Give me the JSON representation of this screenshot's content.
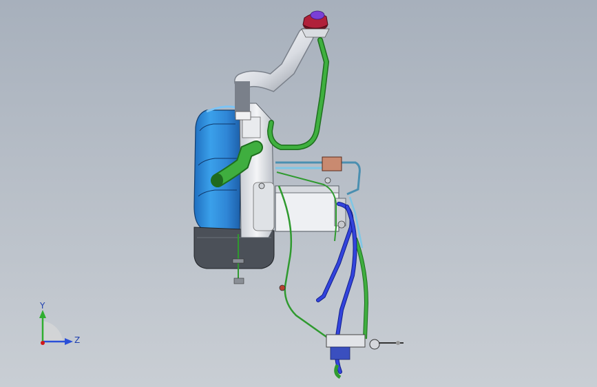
{
  "viewport": {
    "background_top": "#a7b0bc",
    "background_bottom": "#c9ced4"
  },
  "triad": {
    "y_label": "Y",
    "z_label": "Z",
    "y_color": "#2fae2f",
    "z_color": "#2a4fd8",
    "x_color": "#d01818"
  },
  "model": {
    "tank_color": "#2f86d6",
    "tank_bottom_color": "#4a4f57",
    "pipe_color": "#e6e8ec",
    "green_hose_color": "#2f9a2f",
    "blue_hose_color": "#2233c8",
    "light_blue_line_color": "#7ec7e6",
    "filler_cap_color": "#b0203a"
  }
}
